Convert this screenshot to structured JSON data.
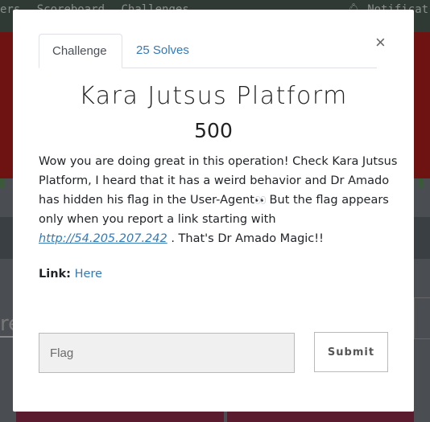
{
  "background": {
    "nav_links": [
      "ers",
      "Scoreboard",
      "Challenges"
    ],
    "notifications_label": "Notificat",
    "heading_fragment": "re"
  },
  "modal": {
    "tabs": [
      {
        "label": "Challenge",
        "active": true
      },
      {
        "label": "25 Solves",
        "active": false
      }
    ],
    "close_symbol": "×",
    "challenge_name": "Kara Jutsus Platform",
    "challenge_value": "500",
    "description": {
      "line1": "Wow you are doing great in this operation! Check Kara Jutsus",
      "line2": "Platform, I heard that it has a weird behavior and Dr Amado",
      "line3a": "has hidden his flag in the User-Agent",
      "eyes": "👀",
      "line3b": " But the flag appears",
      "line4": "only when you report a link starting with",
      "url": "http://54.205.207.242",
      "line5_tail": " . That's Dr Amado Magic!!"
    },
    "link_label": "Link:",
    "link_text": "Here",
    "flag_placeholder": "Flag",
    "flag_value": "",
    "submit_label": "Submit"
  },
  "colors": {
    "accent_link": "#337ab7",
    "banner_red": "#6e1212",
    "navbar": "#2f3a34"
  }
}
